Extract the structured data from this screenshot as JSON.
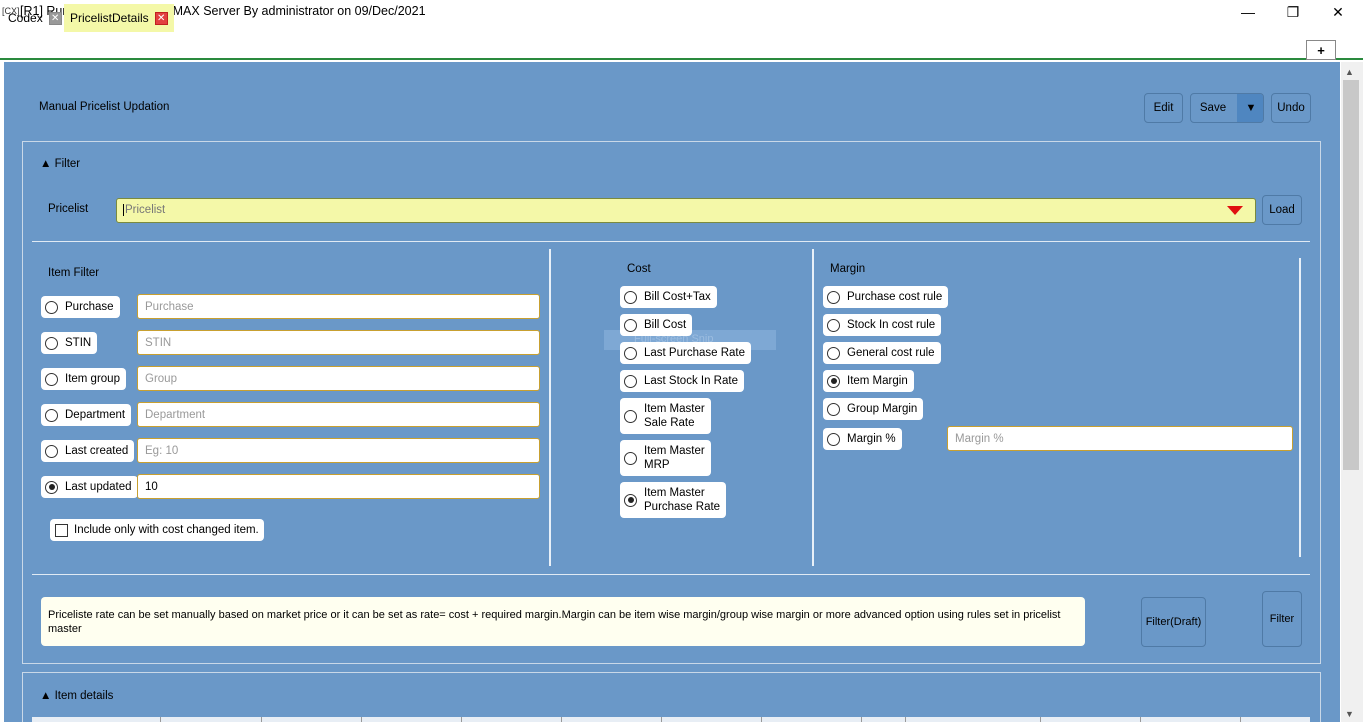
{
  "window": {
    "app_icon": "[CX]",
    "title": "[R1] Running ERP 5.1 on CMAX Server By administrator on 09/Dec/2021",
    "minimize": "—",
    "restore": "❐",
    "close": "✕"
  },
  "tabs": [
    {
      "label": "Codex",
      "close": "✕"
    },
    {
      "label": "PricelistDetails",
      "close": "✕"
    }
  ],
  "tab_add": "+",
  "page": {
    "title": "Manual Pricelist Updation",
    "edit_label": "Edit",
    "save_label": "Save",
    "save_dropdown": "▼",
    "undo_label": "Undo"
  },
  "filter": {
    "header": "▲ Filter",
    "pricelist_label": "Pricelist",
    "pricelist_placeholder": "Pricelist",
    "load_label": "Load"
  },
  "item_filter": {
    "title": "Item Filter",
    "rows": [
      {
        "label": "Purchase",
        "selected": false,
        "placeholder": "Purchase",
        "value": ""
      },
      {
        "label": "STIN",
        "selected": false,
        "placeholder": "STIN",
        "value": ""
      },
      {
        "label": "Item group",
        "selected": false,
        "placeholder": "Group",
        "value": ""
      },
      {
        "label": "Department",
        "selected": false,
        "placeholder": "Department",
        "value": ""
      },
      {
        "label": "Last created",
        "selected": false,
        "placeholder": "Eg: 10",
        "value": ""
      },
      {
        "label": "Last updated",
        "selected": true,
        "placeholder": "",
        "value": "10"
      }
    ],
    "checkbox_label": "Include only with cost changed item."
  },
  "cost": {
    "title": "Cost",
    "options": [
      {
        "line1": "Bill Cost+Tax",
        "line2": "",
        "selected": false
      },
      {
        "line1": "Bill Cost",
        "line2": "",
        "selected": false
      },
      {
        "line1": "Last Purchase Rate",
        "line2": "",
        "selected": false
      },
      {
        "line1": "Last Stock In Rate",
        "line2": "",
        "selected": false
      },
      {
        "line1": "Item Master",
        "line2": "Sale Rate",
        "selected": false
      },
      {
        "line1": "Item Master",
        "line2": "MRP",
        "selected": false
      },
      {
        "line1": "Item Master",
        "line2": "Purchase Rate",
        "selected": true
      }
    ]
  },
  "snip_ghost": "Full-screen Snip",
  "margin": {
    "title": "Margin",
    "options": [
      {
        "label": "Purchase cost rule",
        "selected": false
      },
      {
        "label": "Stock In cost rule",
        "selected": false
      },
      {
        "label": "General cost rule",
        "selected": false
      },
      {
        "label": "Item Margin",
        "selected": true
      },
      {
        "label": "Group Margin",
        "selected": false
      },
      {
        "label": "Margin %",
        "selected": false
      }
    ],
    "margin_placeholder": "Margin %"
  },
  "info_text": "Priceliste rate can be set manually based on market price or it can be set as rate= cost + required margin.Margin can be item wise margin/group wise margin or more advanced option using rules set in pricelist master",
  "filter_draft_label": "Filter(Draft)",
  "filter_label": "Filter",
  "item_details_header": "▲ Item details",
  "scroll": {
    "up": "▲",
    "down": "▼"
  }
}
